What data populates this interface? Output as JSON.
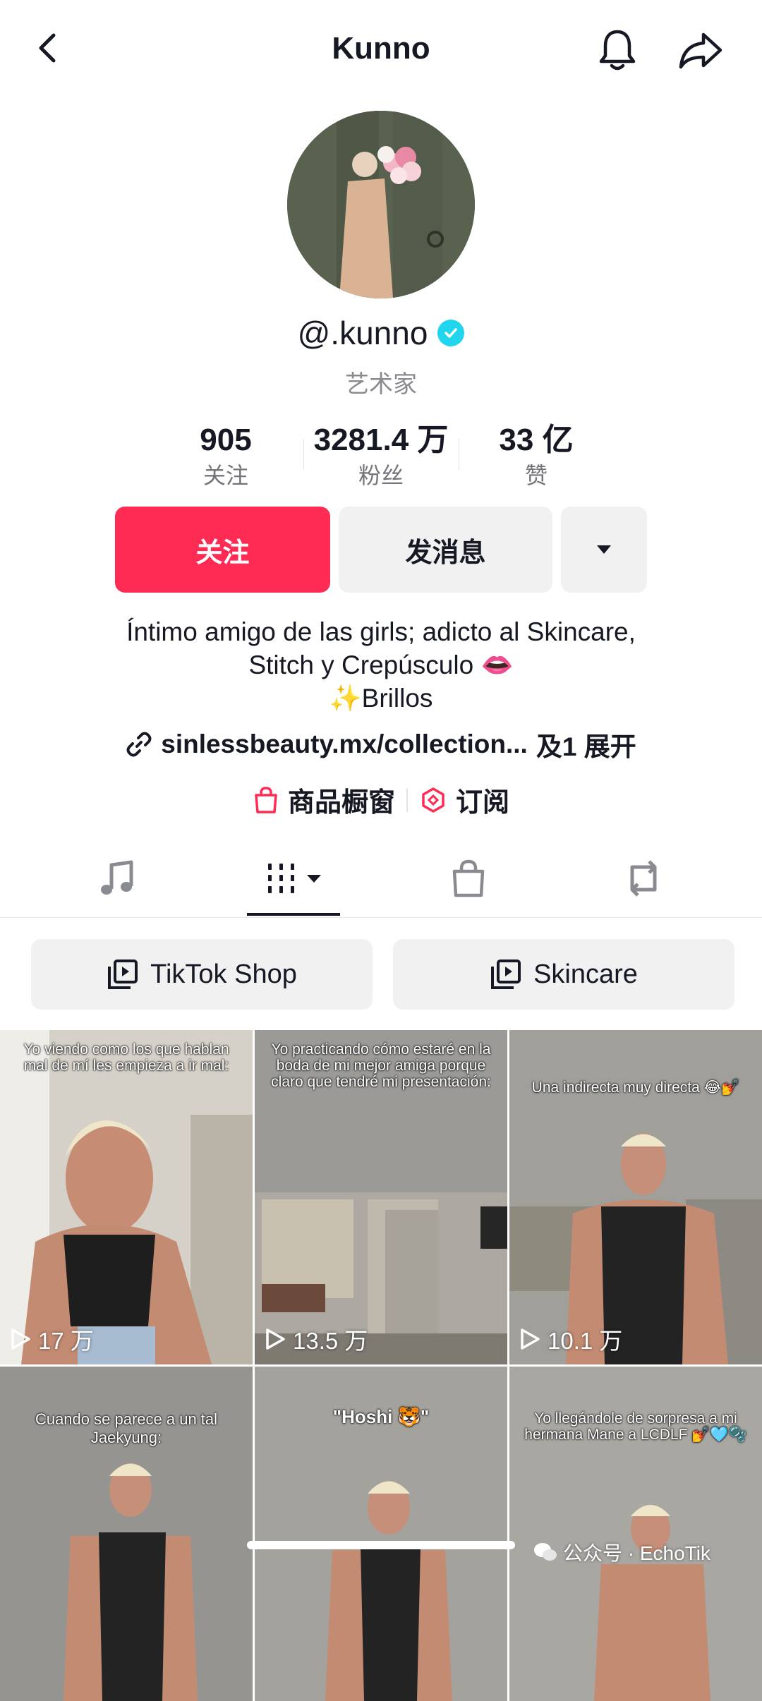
{
  "header": {
    "title": "Kunno"
  },
  "profile": {
    "handle": "@.kunno",
    "category": "艺术家",
    "stats": [
      {
        "value": "905",
        "label": "关注"
      },
      {
        "value": "3281.4 万",
        "label": "粉丝"
      },
      {
        "value": "33 亿",
        "label": "赞"
      }
    ]
  },
  "actions": {
    "follow": "关注",
    "message": "发消息"
  },
  "bio": {
    "line1": "Íntimo amigo de las girls; adicto al Skincare,",
    "line2": "Stitch y Crepúsculo 👄",
    "line3": "✨Brillos",
    "link": "sinlessbeauty.mx/collection...",
    "link_more": "及1 展开"
  },
  "shop": {
    "showcase": "商品橱窗",
    "subscribe": "订阅"
  },
  "playlists": [
    "TikTok Shop",
    "Skincare"
  ],
  "videos": [
    {
      "caption": "Yo viendo como los que hablan mal de mí les empieza a ir mal:",
      "views": "17 万"
    },
    {
      "caption": "Yo practicando cómo estaré en la boda de mi mejor amiga porque claro que tendré mi presentación:",
      "views": "13.5 万"
    },
    {
      "caption": "Una indirecta muy directa 😂💅",
      "views": "10.1 万"
    },
    {
      "caption": "Cuando se parece a un tal Jaekyung:",
      "views": ""
    },
    {
      "caption": "\"Hoshi 🐯\"",
      "views": ""
    },
    {
      "caption": "Yo llegándole de sorpresa a mi hermana Mane a LCDLF 💅🩵🫧",
      "views": ""
    }
  ],
  "watermark": "公众号 · EchoTik",
  "colors": {
    "accent": "#fe2c55",
    "verified": "#20d5ec",
    "text": "#161823",
    "secondary": "#8a8b91",
    "button_bg": "#f1f1f2"
  }
}
